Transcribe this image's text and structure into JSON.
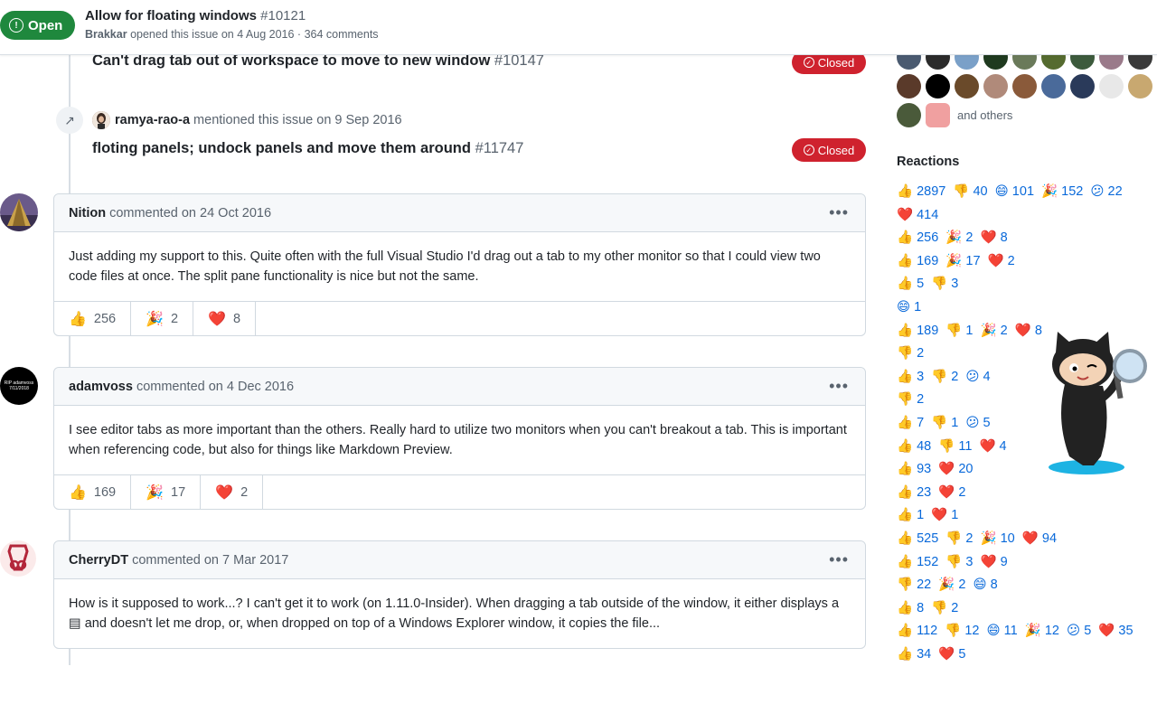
{
  "header": {
    "state": "Open",
    "title": "Allow for floating windows",
    "number": "#10121",
    "author": "Brakkar",
    "meta": "opened this issue on 4 Aug 2016 · 364 comments"
  },
  "timeline": {
    "xref1": {
      "title": "Can't drag tab out of workspace to move to new window",
      "number": "#10147",
      "status": "Closed"
    },
    "mention": {
      "user": "ramya-rao-a",
      "text": "mentioned this issue on 9 Sep 2016"
    },
    "xref2": {
      "title": "floting panels; undock panels and move them around",
      "number": "#11747",
      "status": "Closed"
    }
  },
  "comments": [
    {
      "author": "Nition",
      "meta": "commented on 24 Oct 2016",
      "body": "Just adding my support to this. Quite often with the full Visual Studio I'd drag out a tab to my other monitor so that I could view two code files at once. The split pane functionality is nice but not the same.",
      "reactions": [
        {
          "emoji": "👍",
          "count": "256"
        },
        {
          "emoji": "🎉",
          "count": "2"
        },
        {
          "emoji": "❤️",
          "count": "8"
        }
      ]
    },
    {
      "author": "adamvoss",
      "meta": "commented on 4 Dec 2016",
      "avatar_text": "RIP adamvoss 7/11/2018",
      "body": "I see editor tabs as more important than the others. Really hard to utilize two monitors when you can't breakout a tab. This is important when referencing code, but also for things like Markdown Preview.",
      "reactions": [
        {
          "emoji": "👍",
          "count": "169"
        },
        {
          "emoji": "🎉",
          "count": "17"
        },
        {
          "emoji": "❤️",
          "count": "2"
        }
      ]
    },
    {
      "author": "CherryDT",
      "meta": "commented on 7 Mar 2017",
      "body": "How is it supposed to work...? I can't get it to work (on 1.11.0-Insider). When dragging a tab outside of the window, it either displays a ▤ and doesn't let me drop, or, when dropped on top of a Windows Explorer window, it copies the file..."
    }
  ],
  "sidebar": {
    "and_others": "and others",
    "reactions_title": "Reactions",
    "reaction_lines": [
      "👍 2897  👎 40  😄 101  🎉 152  😕 22",
      "❤️ 414",
      "👍 256  🎉 2  ❤️ 8",
      "👍 169  🎉 17  ❤️ 2",
      "👍 5  👎 3",
      "😄 1",
      "👍 189  👎 1  🎉 2  ❤️ 8",
      "👎 2",
      "👍 3  👎 2  😕 4",
      "👎 2",
      "👍 7  👎 1  😕 5",
      "👍 48  👎 11  ❤️ 4",
      "👍 93  ❤️ 20",
      "👍 23  ❤️ 2",
      "👍 1  ❤️ 1",
      "👍 525  👎 2  🎉 10  ❤️ 94",
      "👍 152  👎 3  ❤️ 9",
      "👎 22  🎉 2  😄 8",
      "👍 8  👎 2",
      "👍 112  👎 12  😄 11  🎉 12  😕 5  ❤️ 35",
      "👍 34  ❤️ 5"
    ]
  },
  "icons": {
    "open": "issue-open-icon",
    "closed": "issue-closed-icon",
    "mention": "cross-reference-icon",
    "menu": "kebab-horizontal-icon"
  }
}
